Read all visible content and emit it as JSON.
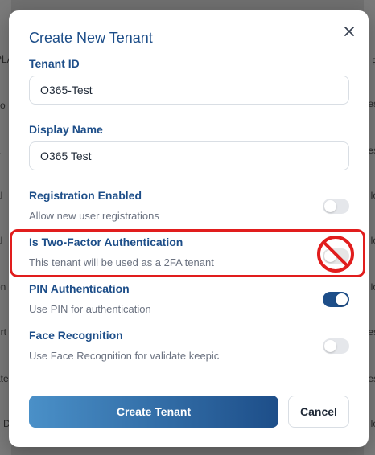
{
  "background": {
    "left_fragments": [
      "PLA",
      "ko",
      "L",
      "al",
      "al",
      "on",
      "urt",
      "ate",
      "e D"
    ],
    "right_fragments": [
      "P",
      "es",
      "es",
      "lo",
      "lo",
      "lo",
      "es",
      "es",
      "lo"
    ]
  },
  "modal": {
    "title": "Create New Tenant",
    "close_icon": "close-icon"
  },
  "form": {
    "tenant_id": {
      "label": "Tenant ID",
      "value": "O365-Test"
    },
    "display_name": {
      "label": "Display Name",
      "value": "O365 Test"
    }
  },
  "options": {
    "registration": {
      "title": "Registration Enabled",
      "description": "Allow new user registrations",
      "enabled": false
    },
    "two_factor": {
      "title": "Is Two-Factor Authentication",
      "description": "This tenant will be used as a 2FA tenant",
      "enabled": false
    },
    "pin": {
      "title": "PIN Authentication",
      "description": "Use PIN for authentication",
      "enabled": true
    },
    "face": {
      "title": "Face Recognition",
      "description": "Use Face Recognition for validate keepic",
      "enabled": false
    }
  },
  "annotation": {
    "highlight_color": "#e11d1d",
    "icon": "prohibited-icon"
  },
  "actions": {
    "create_label": "Create Tenant",
    "cancel_label": "Cancel"
  },
  "colors": {
    "brand": "#1d4e89",
    "accent_gradient_start": "#4a90c8"
  }
}
